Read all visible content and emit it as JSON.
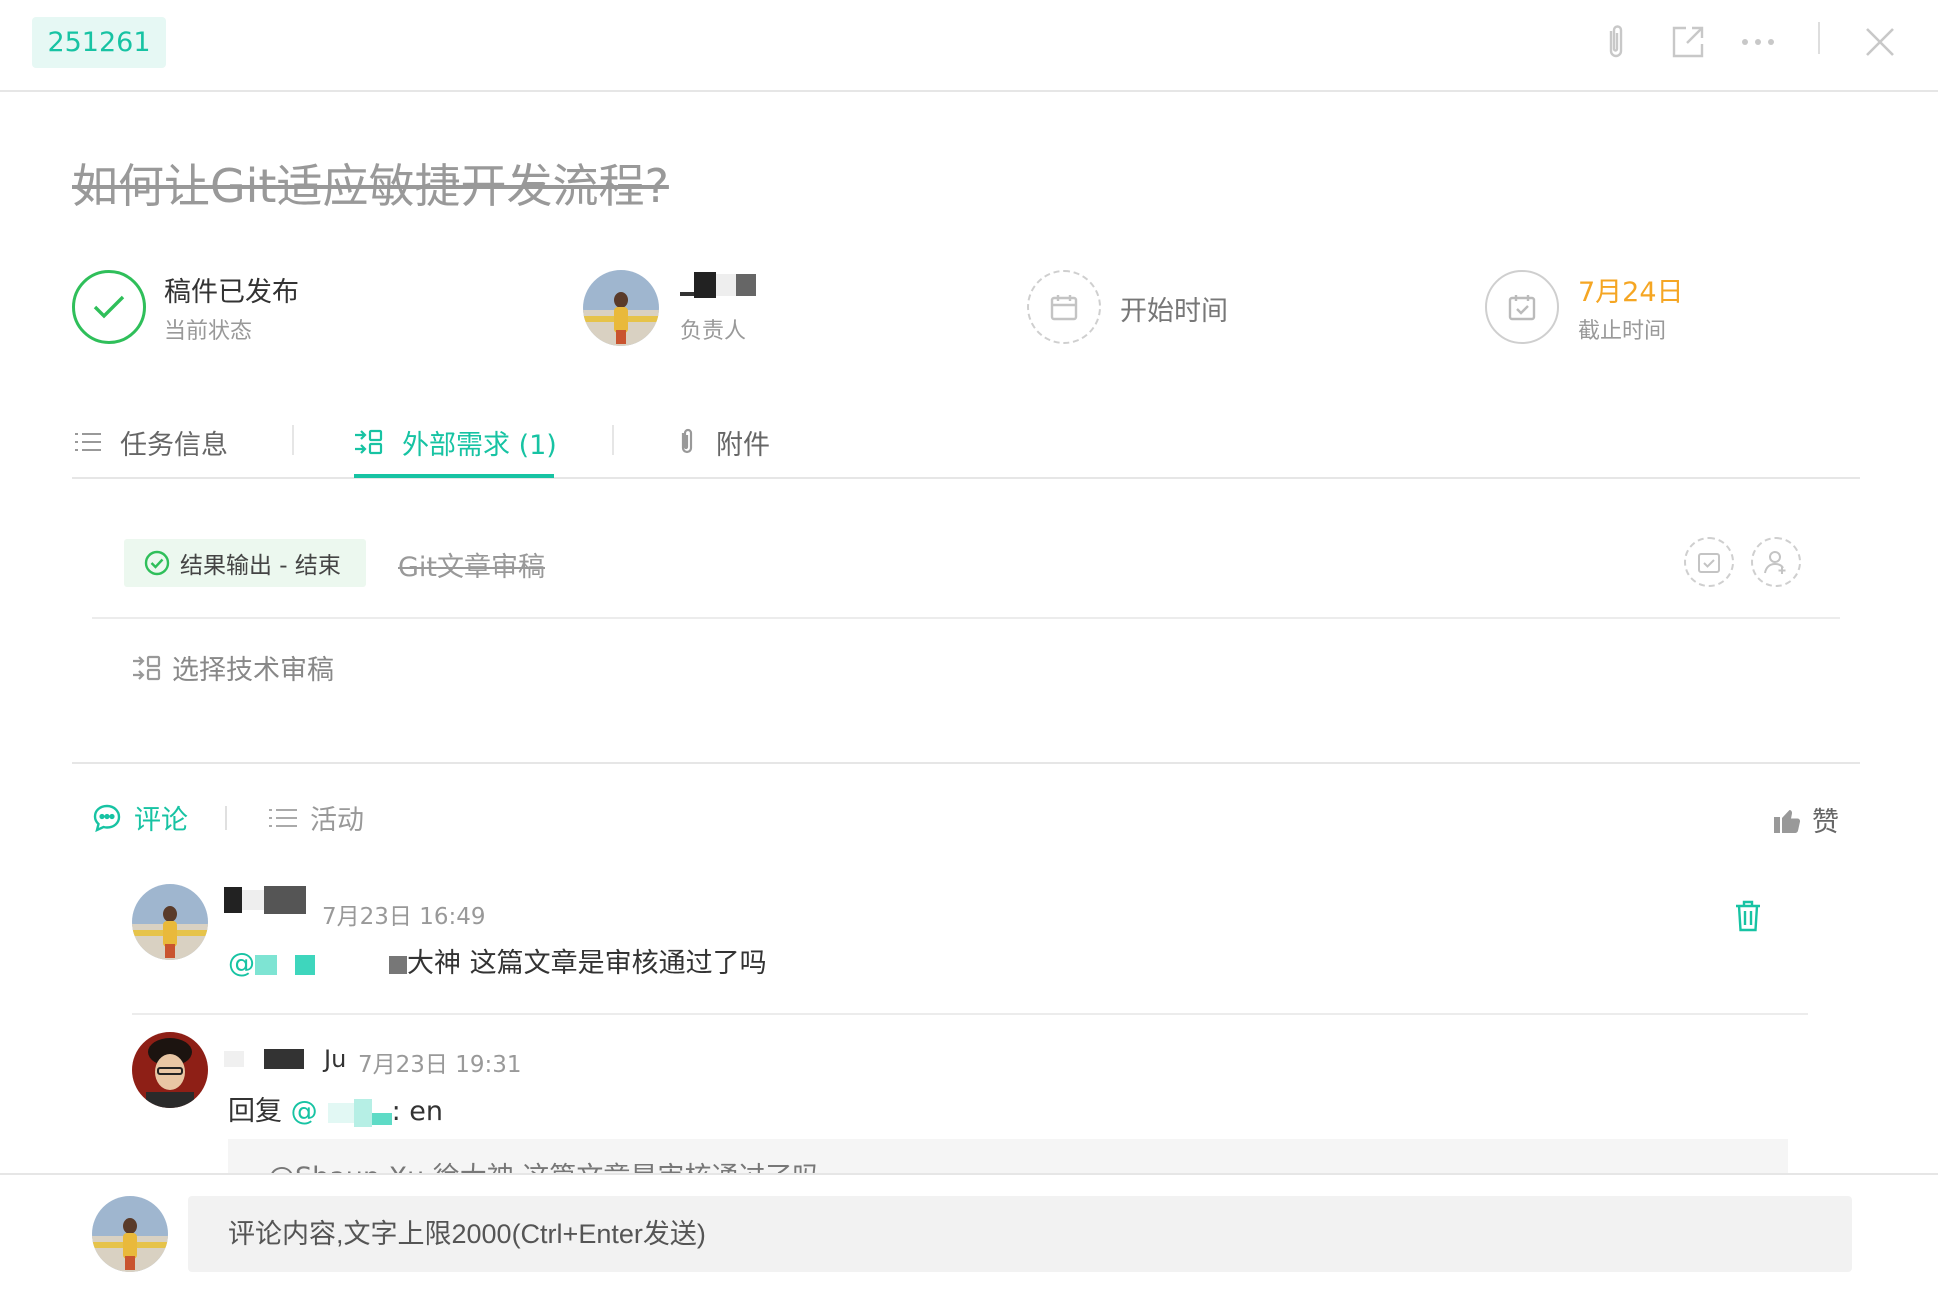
{
  "header": {
    "task_id": "251261"
  },
  "task": {
    "title": "如何让Git适应敏捷开发流程?"
  },
  "meta": {
    "status_value": "稿件已发布",
    "status_label": "当前状态",
    "assignee_label": "负责人",
    "start_label": "开始时间",
    "due_value": "7月24日",
    "due_label": "截止时间"
  },
  "tabs": [
    {
      "label": "任务信息"
    },
    {
      "label": "外部需求 (1)"
    },
    {
      "label": "附件"
    }
  ],
  "requirement": {
    "status": "结果输出 - 结束",
    "title": "Git文章审稿",
    "select_link": "选择技术审稿"
  },
  "comment_tabs": {
    "comment": "评论",
    "activity": "活动",
    "like": "赞"
  },
  "comments": [
    {
      "time": "7月23日 16:49",
      "mention": "@",
      "text": "大神 这篇文章是审核通过了吗"
    },
    {
      "author_suffix": "Ju",
      "time": "7月23日 19:31",
      "reply_prefix": "回复",
      "mention": "@",
      "text": ": en",
      "quote": "@Shaun Xu 徐大神 这篇文章是审核通过了吗"
    }
  ],
  "footer": {
    "placeholder": "评论内容,文字上限2000(Ctrl+Enter发送)"
  },
  "colors": {
    "accent": "#17c3a3",
    "success": "#2fbf5a",
    "due": "#f5a623"
  }
}
